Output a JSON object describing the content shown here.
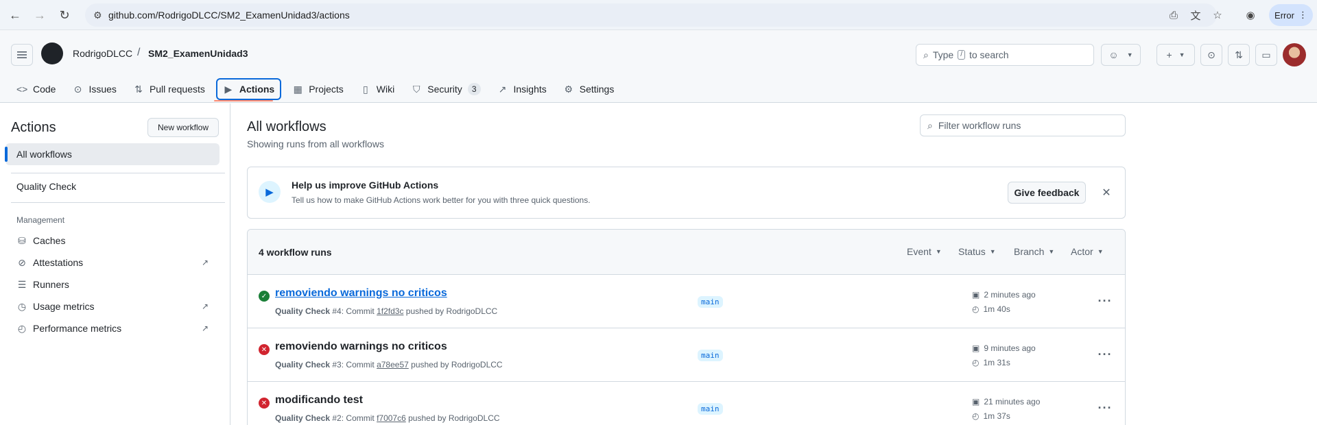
{
  "browser": {
    "url": "github.com/RodrigoDLCC/SM2_ExamenUnidad3/actions",
    "profile_label": "Error"
  },
  "header": {
    "owner": "RodrigoDLCC",
    "separator": "/",
    "repo": "SM2_ExamenUnidad3",
    "search_prefix": "Type",
    "search_key": "/",
    "search_suffix": "to search"
  },
  "tabs": [
    {
      "label": "Code",
      "icon": "code-icon"
    },
    {
      "label": "Issues",
      "icon": "issue-icon"
    },
    {
      "label": "Pull requests",
      "icon": "pull-request-icon"
    },
    {
      "label": "Actions",
      "icon": "play-icon"
    },
    {
      "label": "Projects",
      "icon": "table-icon"
    },
    {
      "label": "Wiki",
      "icon": "book-icon"
    },
    {
      "label": "Security",
      "icon": "shield-icon",
      "count": "3"
    },
    {
      "label": "Insights",
      "icon": "graph-icon"
    },
    {
      "label": "Settings",
      "icon": "gear-icon"
    }
  ],
  "sidebar": {
    "title": "Actions",
    "new_workflow": "New workflow",
    "all_workflows": "All workflows",
    "workflow": "Quality Check",
    "group_label": "Management",
    "management": [
      {
        "label": "Caches",
        "icon": "database-icon"
      },
      {
        "label": "Attestations",
        "icon": "check-circle-icon",
        "external": "↗"
      },
      {
        "label": "Runners",
        "icon": "server-icon"
      },
      {
        "label": "Usage metrics",
        "icon": "clock-icon",
        "external": "↗"
      },
      {
        "label": "Performance metrics",
        "icon": "stopwatch-icon",
        "external": "↗"
      }
    ]
  },
  "main": {
    "title": "All workflows",
    "subtitle": "Showing runs from all workflows",
    "filter_placeholder": "Filter workflow runs",
    "banner": {
      "title": "Help us improve GitHub Actions",
      "text": "Tell us how to make GitHub Actions work better for you with three quick questions.",
      "button": "Give feedback"
    },
    "runs_count": "4 workflow runs",
    "filters": [
      "Event",
      "Status",
      "Branch",
      "Actor"
    ],
    "runs": [
      {
        "status": "success",
        "title": "removiendo warnings no criticos",
        "workflow": "Quality Check",
        "number": "#4",
        "commit_label": ": Commit",
        "sha": "1f2fd3c",
        "pushed": "pushed by",
        "author": "RodrigoDLCC",
        "branch": "main",
        "when": "2 minutes ago",
        "duration": "1m 40s"
      },
      {
        "status": "failure",
        "title": "removiendo warnings no criticos",
        "workflow": "Quality Check",
        "number": "#3",
        "commit_label": ": Commit",
        "sha": "a78ee57",
        "pushed": "pushed by",
        "author": "RodrigoDLCC",
        "branch": "main",
        "when": "9 minutes ago",
        "duration": "1m 31s"
      },
      {
        "status": "failure",
        "title": "modificando test",
        "workflow": "Quality Check",
        "number": "#2",
        "commit_label": ": Commit",
        "sha": "f7007c6",
        "pushed": "pushed by",
        "author": "RodrigoDLCC",
        "branch": "main",
        "when": "21 minutes ago",
        "duration": "1m 37s"
      }
    ]
  },
  "colors": {
    "accent": "#0969da",
    "success": "#1a7f37",
    "failure": "#d1242f",
    "tab_underline": "#fd8c73"
  }
}
